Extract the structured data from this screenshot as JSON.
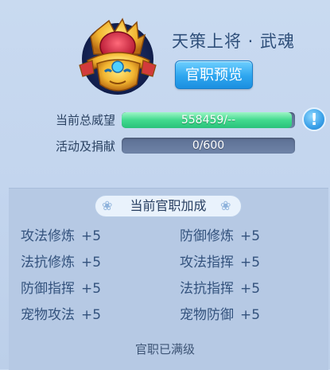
{
  "rank": {
    "title": "天策上将 · 武魂",
    "preview_button": "官职预览"
  },
  "stats": [
    {
      "label": "当前总威望",
      "value_text": "558459/--",
      "fill_fraction": 0.98,
      "bar_color": "#3fd78c"
    },
    {
      "label": "活动及捐献",
      "value_text": "0/600",
      "fill_fraction": 0.0,
      "bar_color": "#3fd78c"
    }
  ],
  "info_icon": {
    "glyph": "!",
    "icon": "info-icon"
  },
  "bonus_panel": {
    "title": "当前官职加成",
    "rows": [
      [
        {
          "name": "攻法修炼",
          "value": "+5"
        },
        {
          "name": "防御修炼",
          "value": "+5"
        }
      ],
      [
        {
          "name": "法抗修炼",
          "value": "+5"
        },
        {
          "name": "攻法指挥",
          "value": "+5"
        }
      ],
      [
        {
          "name": "防御指挥",
          "value": "+5"
        },
        {
          "name": "法抗指挥",
          "value": "+5"
        }
      ],
      [
        {
          "name": "宠物攻法",
          "value": "+5"
        },
        {
          "name": "宠物防御",
          "value": "+5"
        }
      ]
    ],
    "footer": "官职已满级"
  },
  "colors": {
    "accent": "#2ea6ef",
    "background": "#c6d8ef",
    "panel": "#b6c9e4",
    "text": "#33527d"
  }
}
